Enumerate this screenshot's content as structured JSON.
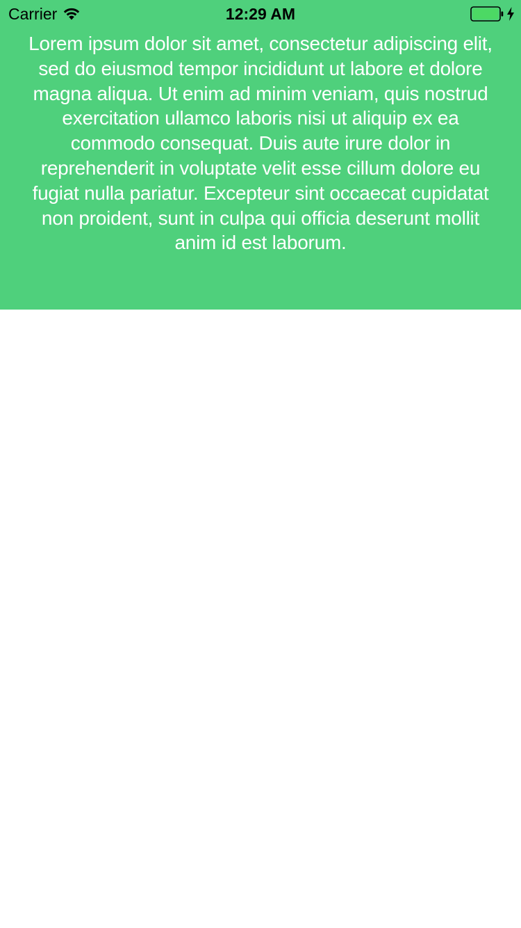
{
  "status_bar": {
    "carrier": "Carrier",
    "time": "12:29 AM",
    "battery_color": "#4cd964",
    "icons": [
      "wifi-icon",
      "battery-icon",
      "charging-bolt-icon"
    ]
  },
  "content": {
    "background_color": "#4fd07c",
    "text_color": "#ffffff",
    "paragraph": "Lorem ipsum dolor sit amet, consectetur adipiscing elit, sed do eiusmod tempor incididunt ut labore et dolore magna aliqua. Ut enim ad minim veniam, quis nostrud exercitation ullamco laboris nisi ut aliquip ex ea commodo consequat. Duis aute irure dolor in reprehenderit in voluptate velit esse cillum dolore eu fugiat nulla pariatur. Excepteur sint occaecat cupidatat non proident, sunt in culpa qui officia deserunt mollit anim id est laborum."
  }
}
